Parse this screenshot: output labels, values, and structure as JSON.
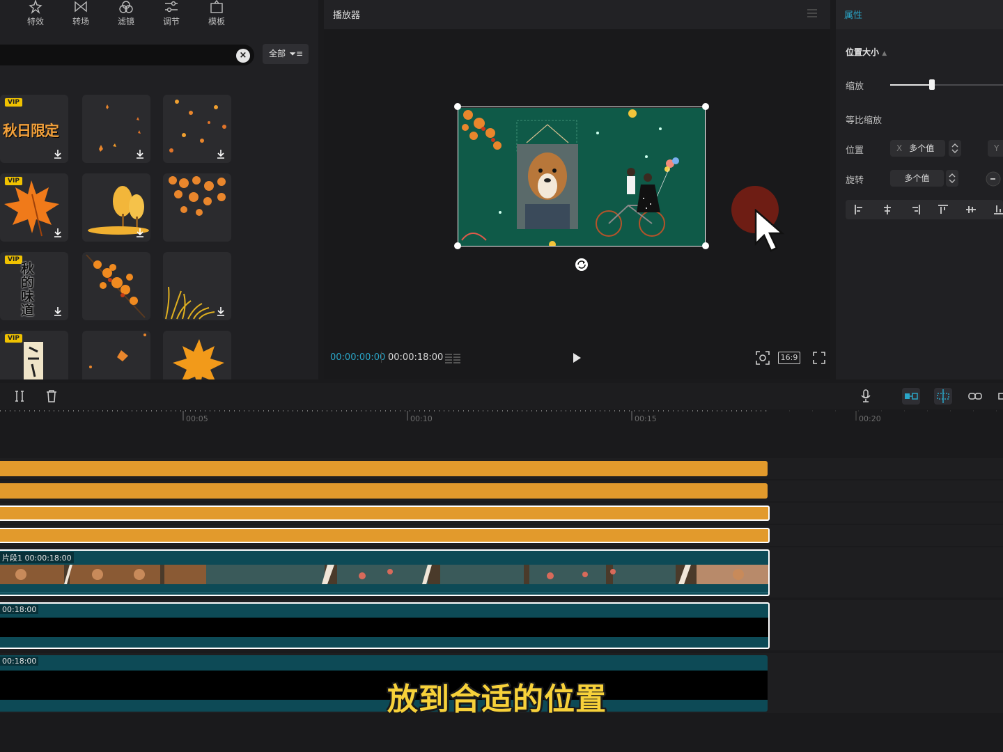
{
  "toolbar": {
    "items": [
      {
        "label": "特效",
        "icon": "sparkle-icon"
      },
      {
        "label": "转场",
        "icon": "bowtie-icon"
      },
      {
        "label": "滤镜",
        "icon": "circles-icon"
      },
      {
        "label": "调节",
        "icon": "sliders-icon"
      },
      {
        "label": "模板",
        "icon": "template-icon"
      }
    ]
  },
  "search": {
    "value": "",
    "clear_icon": "close-icon",
    "filter_label": "全部",
    "filter_icon": "filter-icon"
  },
  "stickers": {
    "vip_badge": "VIP",
    "items": [
      {
        "name": "秋日限定",
        "vip": true,
        "download": true
      },
      {
        "name": "falling-leaves-1",
        "vip": false,
        "download": true
      },
      {
        "name": "falling-leaves-2",
        "vip": false,
        "download": true
      },
      {
        "name": "maple-leaf",
        "vip": true,
        "download": true
      },
      {
        "name": "yellow-trees",
        "vip": false,
        "download": true
      },
      {
        "name": "leaf-branch",
        "vip": false,
        "download": false
      },
      {
        "name": "秋的味道",
        "vip": true,
        "download": true
      },
      {
        "name": "autumn-branch",
        "vip": false,
        "download": false
      },
      {
        "name": "golden-grass",
        "vip": false,
        "download": true
      },
      {
        "name": "calligraphy-scroll",
        "vip": true,
        "download": false
      },
      {
        "name": "single-leaf",
        "vip": false,
        "download": false
      },
      {
        "name": "orange-maple",
        "vip": false,
        "download": false
      }
    ]
  },
  "player": {
    "title": "播放器",
    "current_time": "00:00:00:00",
    "total_time": "00:00:18:00",
    "ratio": "16:9"
  },
  "properties": {
    "title": "属性",
    "section": "位置大小",
    "scale_label": "缩放",
    "scale_value": 0.37,
    "uniform_label": "等比缩放",
    "position_label": "位置",
    "position_x_axis": "X",
    "position_x_value": "多个值",
    "position_y_axis": "Y",
    "rotation_label": "旋转",
    "rotation_value": "多个值"
  },
  "timeline": {
    "ruler": [
      "00:05",
      "00:10",
      "00:15",
      "00:20"
    ],
    "main_clip": {
      "label": "片段1",
      "duration": "00:00:18:00"
    },
    "track2_label": "00:18:00",
    "track3_label": "00:18:00"
  },
  "overlay_subtitle": "放到合适的位置",
  "colors": {
    "accent": "#2aa6c8",
    "clip_orange": "#e29a2c",
    "clip_teal": "#0d4a56",
    "subtitle": "#f7d13a"
  }
}
